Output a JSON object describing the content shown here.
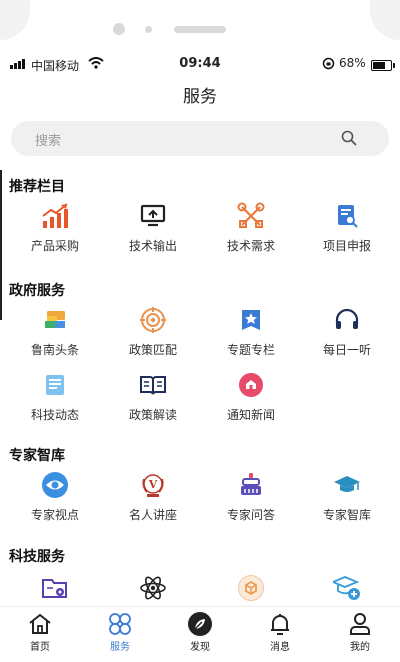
{
  "status": {
    "carrier": "中国移动",
    "time": "09:44",
    "battery_percent": "68%",
    "battery_level": 0.68
  },
  "header": {
    "title": "服务"
  },
  "search": {
    "placeholder": "搜索"
  },
  "sections": [
    {
      "title": "推荐栏目",
      "items": [
        {
          "label": "产品采购",
          "icon": "chart-up-icon",
          "color": "#e8572a"
        },
        {
          "label": "技术输出",
          "icon": "monitor-upload-icon",
          "color": "#222222"
        },
        {
          "label": "技术需求",
          "icon": "tools-icon",
          "color": "#e8793a"
        },
        {
          "label": "项目申报",
          "icon": "document-search-icon",
          "color": "#3a7bd5"
        }
      ]
    },
    {
      "title": "政府服务",
      "items": [
        {
          "label": "鲁南头条",
          "icon": "layers-icon",
          "color": "#f2a93b"
        },
        {
          "label": "政策匹配",
          "icon": "target-icon",
          "color": "#e8944a"
        },
        {
          "label": "专题专栏",
          "icon": "star-bookmark-icon",
          "color": "#3a7bd5"
        },
        {
          "label": "每日一听",
          "icon": "headphones-icon",
          "color": "#1f2d5a"
        },
        {
          "label": "科技动态",
          "icon": "notepad-icon",
          "color": "#4aa3e0"
        },
        {
          "label": "政策解读",
          "icon": "open-book-icon",
          "color": "#1f2d5a"
        },
        {
          "label": "通知新闻",
          "icon": "bell-home-icon",
          "color": "#e84a6a"
        }
      ]
    },
    {
      "title": "专家智库",
      "items": [
        {
          "label": "专家视点",
          "icon": "eye-icon",
          "color": "#3a8fe0"
        },
        {
          "label": "名人讲座",
          "icon": "laurel-v-icon",
          "color": "#b8392b"
        },
        {
          "label": "专家问答",
          "icon": "cake-stack-icon",
          "color": "#5a4fb8"
        },
        {
          "label": "专家智库",
          "icon": "graduation-cap-icon",
          "color": "#2a8fc0"
        }
      ]
    },
    {
      "title": "科技服务",
      "items": [
        {
          "label": "",
          "icon": "folder-gear-icon",
          "color": "#5a3fb0"
        },
        {
          "label": "",
          "icon": "atom-icon",
          "color": "#222222"
        },
        {
          "label": "",
          "icon": "box-circle-icon",
          "color": "#e8944a"
        },
        {
          "label": "",
          "icon": "cap-plus-icon",
          "color": "#3a9ad8"
        }
      ]
    }
  ],
  "tabbar": {
    "tabs": [
      {
        "label": "首页",
        "icon": "home-icon",
        "active": false
      },
      {
        "label": "服务",
        "icon": "clover-icon",
        "active": true
      },
      {
        "label": "发现",
        "icon": "compass-leaf-icon",
        "active": false
      },
      {
        "label": "消息",
        "icon": "bell-icon",
        "active": false
      },
      {
        "label": "我的",
        "icon": "user-icon",
        "active": false
      }
    ],
    "active_color": "#3a7bd5"
  }
}
